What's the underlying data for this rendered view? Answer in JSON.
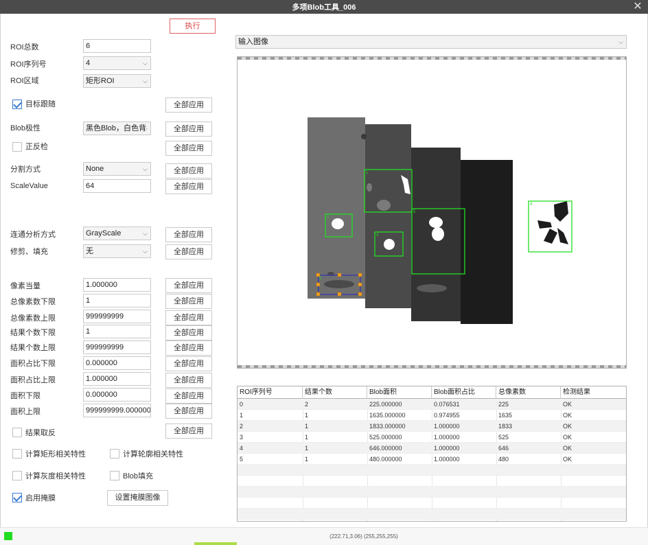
{
  "window": {
    "title": "多项Blob工具_006",
    "close_glyph": "✕"
  },
  "toolbar": {
    "execute_label": "执行"
  },
  "apply_all_label": "全部应用",
  "form": {
    "roi_count": {
      "label": "ROI总数",
      "value": "6"
    },
    "roi_index": {
      "label": "ROI序列号",
      "value": "4"
    },
    "roi_region": {
      "label": "ROI区域",
      "value": "矩形ROI"
    },
    "target_follow": {
      "label": "目标跟随",
      "checked": true
    },
    "blob_polarity": {
      "label": "Blob极性",
      "value": "黑色Blob，白色背"
    },
    "pos_neg_check": {
      "label": "正反检",
      "checked": false
    },
    "split_mode": {
      "label": "分割方式",
      "value": "None"
    },
    "scale_value": {
      "label": "ScaleValue",
      "value": "64"
    },
    "connectivity": {
      "label": "连通分析方式",
      "value": "GrayScale"
    },
    "trim_fill": {
      "label": "修剪、填充",
      "value": "无"
    },
    "pixel_equiv": {
      "label": "像素当量",
      "value": "1.000000"
    },
    "total_px_min": {
      "label": "总像素数下限",
      "value": "1"
    },
    "total_px_max": {
      "label": "总像素数上限",
      "value": "999999999"
    },
    "result_count_min": {
      "label": "结果个数下限",
      "value": "1"
    },
    "result_count_max": {
      "label": "结果个数上限",
      "value": "999999999"
    },
    "area_ratio_min": {
      "label": "面积占比下限",
      "value": "0.000000"
    },
    "area_ratio_max": {
      "label": "面积占比上限",
      "value": "1.000000"
    },
    "area_min": {
      "label": "面积下限",
      "value": "0.000000"
    },
    "area_max": {
      "label": "面积上限",
      "value": "999999999.000000"
    },
    "result_invert": {
      "label": "结果取反",
      "checked": false
    },
    "calc_rect": {
      "label": "计算矩形相关特性",
      "checked": false
    },
    "calc_contour": {
      "label": "计算轮廓相关特性",
      "checked": false
    },
    "calc_gray": {
      "label": "计算灰度相关特性",
      "checked": false
    },
    "blob_fill": {
      "label": "Blob填充",
      "checked": false
    },
    "enable_mask": {
      "label": "启用掩膜",
      "checked": true
    },
    "set_mask_button": "设置掩膜图像"
  },
  "image_source": {
    "value": "输入图像"
  },
  "roi_labels": [
    "0",
    "1",
    "2",
    "3",
    "4",
    "5"
  ],
  "table": {
    "headers": [
      "ROI序列号",
      "结果个数",
      "Blob面积",
      "Blob面积占比",
      "总像素数",
      "检测结果"
    ],
    "rows": [
      [
        "0",
        "2",
        "225.000000",
        "0.076531",
        "225",
        "OK"
      ],
      [
        "1",
        "1",
        "1635.000000",
        "0.974955",
        "1635",
        "OK"
      ],
      [
        "2",
        "1",
        "1833.000000",
        "1.000000",
        "1833",
        "OK"
      ],
      [
        "3",
        "1",
        "525.000000",
        "1.000000",
        "525",
        "OK"
      ],
      [
        "4",
        "1",
        "646.000000",
        "1.000000",
        "646",
        "OK"
      ],
      [
        "5",
        "1",
        "480.000000",
        "1.000000",
        "480",
        "OK"
      ]
    ]
  },
  "status": {
    "coords": "(222.71,3.06)  (255,255,255)"
  },
  "colors": {
    "roi": "#22dd22",
    "selected_roi": "#3a3aaa",
    "handle": "#f0a020",
    "execute_border": "#e06060"
  }
}
